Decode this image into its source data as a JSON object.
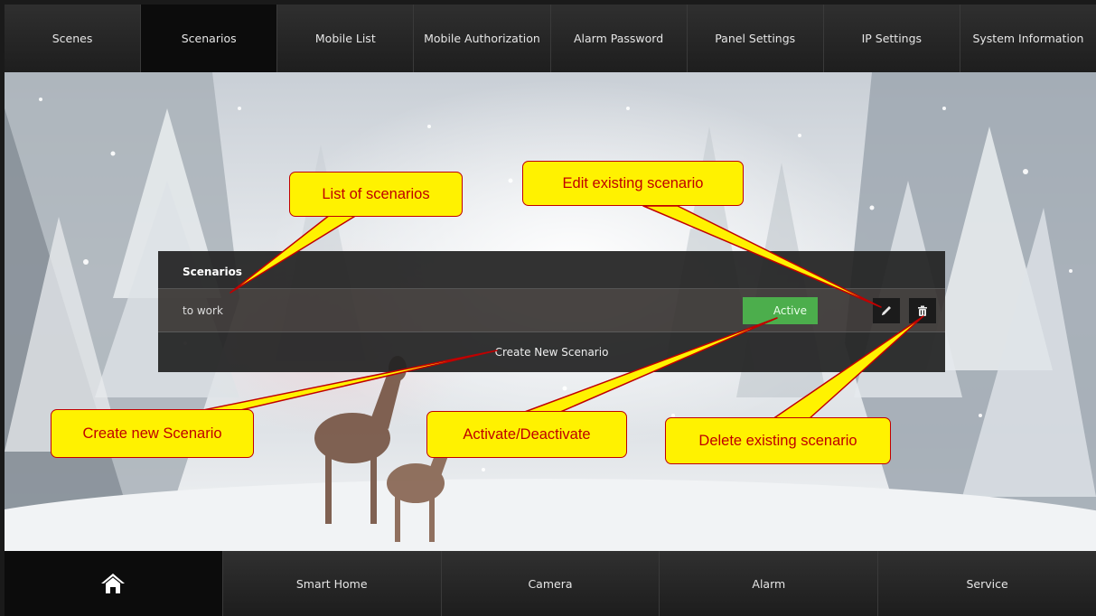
{
  "top_nav": {
    "tabs": [
      {
        "label": "Scenes"
      },
      {
        "label": "Scenarios",
        "active": true
      },
      {
        "label": "Mobile List"
      },
      {
        "label": "Mobile Authorization"
      },
      {
        "label": "Alarm Password"
      },
      {
        "label": "Panel Settings"
      },
      {
        "label": "IP Settings"
      },
      {
        "label": "System Information"
      }
    ]
  },
  "panel": {
    "title": "Scenarios",
    "rows": [
      {
        "name": "to work",
        "status_label": "Active",
        "status_color": "#4cae4c"
      }
    ],
    "create_label": "Create New Scenario"
  },
  "callouts": {
    "list": "List of scenarios",
    "edit": "Edit existing scenario",
    "create": "Create new Scenario",
    "activate": "Activate/Deactivate",
    "delete": "Delete existing scenario"
  },
  "bottom_nav": {
    "home_icon": "home-icon",
    "tabs": [
      {
        "label": "Smart Home"
      },
      {
        "label": "Camera"
      },
      {
        "label": "Alarm"
      },
      {
        "label": "Service"
      }
    ]
  },
  "colors": {
    "callout_fill": "#fff200",
    "callout_text": "#c00000",
    "active_green": "#4cae4c"
  }
}
